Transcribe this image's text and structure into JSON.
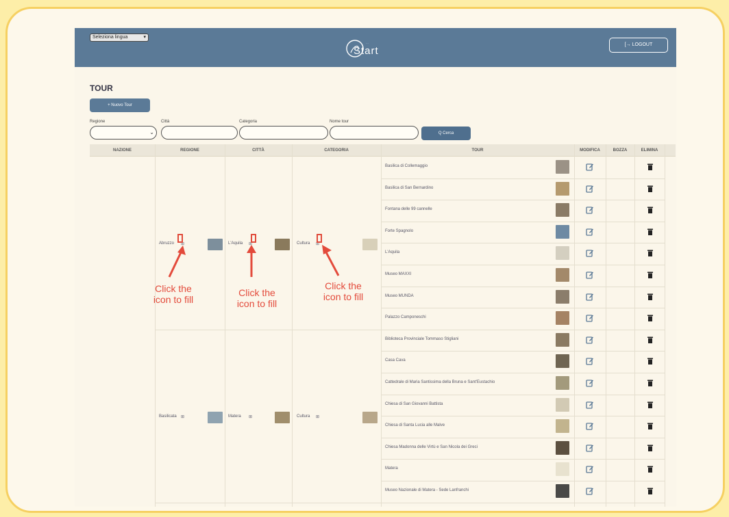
{
  "navbar": {
    "language_select": "Seleziona lingua",
    "logo_text": "Start",
    "logo_subtitle": "…",
    "logout_label": "[→ LOGOUT"
  },
  "page": {
    "title": "TOUR",
    "new_tour_label": "+ Nuovo Tour"
  },
  "filters": {
    "regione_label": "Regione",
    "citta_label": "Città",
    "categoria_label": "Categoria",
    "nome_tour_label": "Nome tour",
    "search_label": "Q Cerca"
  },
  "table": {
    "headers": [
      "NAZIONE",
      "REGIONE",
      "CITTÀ",
      "CATEGORIA",
      "TOUR",
      "MODIFICA",
      "BOZZA",
      "ELIMINA"
    ],
    "groups": [
      {
        "regione": "Abruzzo",
        "citta": "L'Aquila",
        "categoria": "Cultura",
        "tours": [
          "Basilica di Collemaggio",
          "Basilica di San Bernardino",
          "Fontana delle 99 cannelle",
          "Forte Spagnolo",
          "L'Aquila",
          "Museo MAXXI",
          "Museo MUNDA",
          "Palazzo Camponeschi"
        ]
      },
      {
        "regione": "Basilicata",
        "citta": "Matera",
        "categoria": "Cultura",
        "tours": [
          "Biblioteca Provinciale Tommaso Stigliani",
          "Casa Cava",
          "Cattedrale di Maria Santissima della Bruna e Sant'Eustachio",
          "Chiesa di San Giovanni Battista",
          "Chiesa di Santa Lucia alle Malve",
          "Chiesa Madonna delle Virtù e San Nicola dei Greci",
          "Matera",
          "Museo Nazionale di Matera - Sede Lanfranchi"
        ]
      }
    ]
  },
  "annotations": {
    "label_1": "Click the icon to fill",
    "label_2": "Click the icon to fill",
    "label_3": "Click the icon to fill"
  },
  "colors": {
    "navbar": "#5b7a97",
    "annotation": "#e34a3b",
    "frame_border": "#f6d062",
    "background": "#fdeea8"
  }
}
